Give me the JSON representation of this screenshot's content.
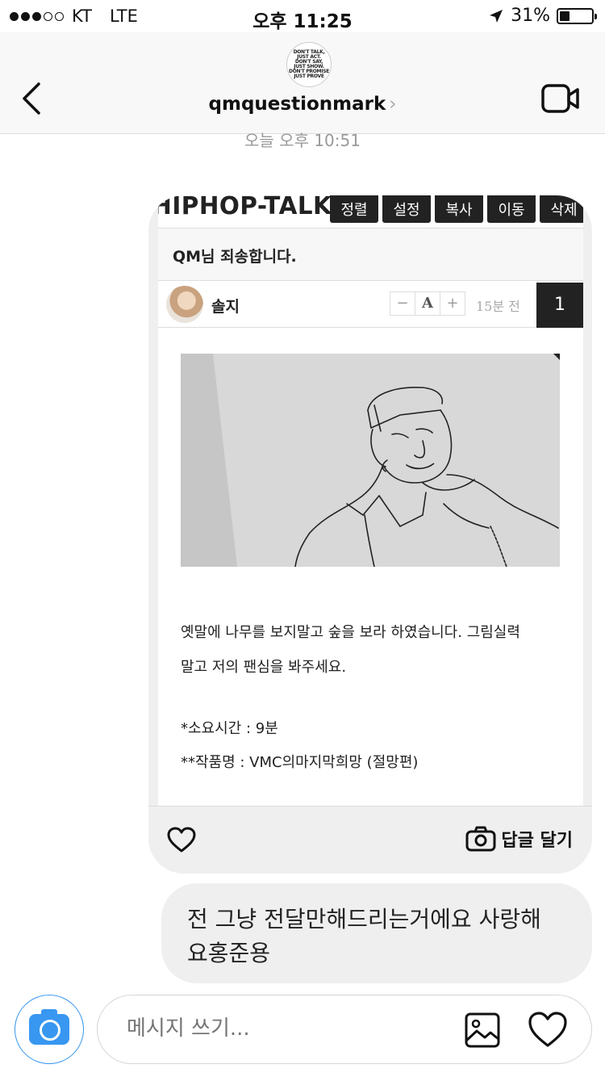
{
  "status_bar": {
    "carrier": "KT",
    "network": "LTE",
    "time": "오후 11:25",
    "battery": "31%",
    "battery_level": 0.31
  },
  "header": {
    "username": "qmquestionmark",
    "logo_lines": [
      "DON'T TALK,",
      "JUST ACT.",
      "DON'T SAY,",
      "JUST SHOW.",
      "DON'T PROMISE",
      "JUST PROVE"
    ]
  },
  "conversation": {
    "timestamp": "오늘 오후 10:51"
  },
  "shared_post": {
    "site_title": "HIPHOP-TALK",
    "tabs": [
      "정렬",
      "설정",
      "복사",
      "이동",
      "삭제"
    ],
    "post_title": "QM님 죄송합니다.",
    "author": "솔지",
    "font_minus": "−",
    "font_a": "A",
    "font_plus": "+",
    "time_ago": "15분 전",
    "number": "1",
    "body_line1": "옛말에 나무를 보지말고 숲을 보라 하였습니다. 그림실력",
    "body_line2": "말고 저의 팬심을 봐주세요.",
    "meta_time": "*소요시간 : 9분",
    "meta_title": "**작품명 : VMC의마지막희망 (절망편)",
    "reply_label": "답글 달기"
  },
  "message": {
    "line1": "전 그냥 전달만해드리는거에요 사랑해",
    "line2": "요홍준용"
  },
  "composer": {
    "placeholder": "메시지 쓰기..."
  }
}
